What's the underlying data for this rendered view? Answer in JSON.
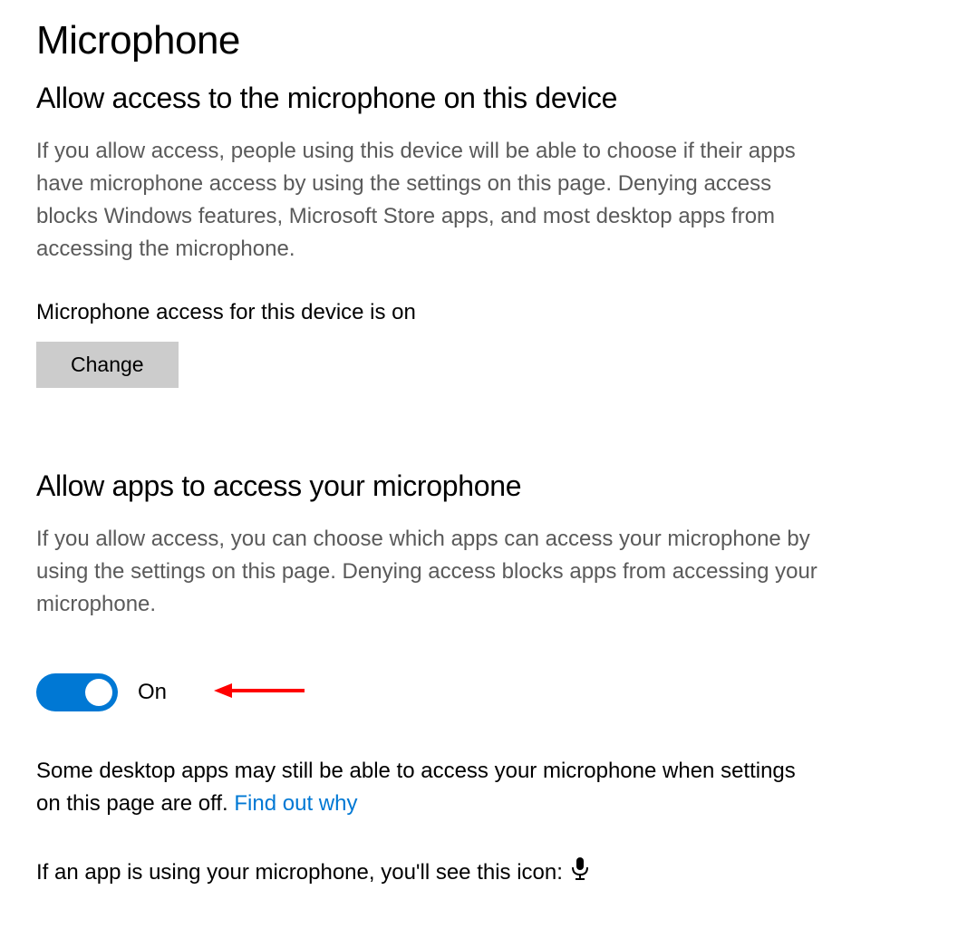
{
  "page_title": "Microphone",
  "section1": {
    "title": "Allow access to the microphone on this device",
    "description": "If you allow access, people using this device will be able to choose if their apps have microphone access by using the settings on this page. Denying access blocks Windows features, Microsoft Store apps, and most desktop apps from accessing the microphone.",
    "status": "Microphone access for this device is on",
    "change_button": "Change"
  },
  "section2": {
    "title": "Allow apps to access your microphone",
    "description": "If you allow access, you can choose which apps can access your microphone by using the settings on this page. Denying access blocks apps from accessing your microphone.",
    "toggle_state": "On",
    "toggle_on": true,
    "desktop_note_part1": "Some desktop apps may still be able to access your microphone when settings on this page are off. ",
    "link_text": "Find out why",
    "icon_note": "If an app is using your microphone, you'll see this icon:"
  },
  "colors": {
    "accent": "#0078d4",
    "button_bg": "#cccccc",
    "text_muted": "#5a5a5a",
    "arrow": "#ff0000"
  }
}
